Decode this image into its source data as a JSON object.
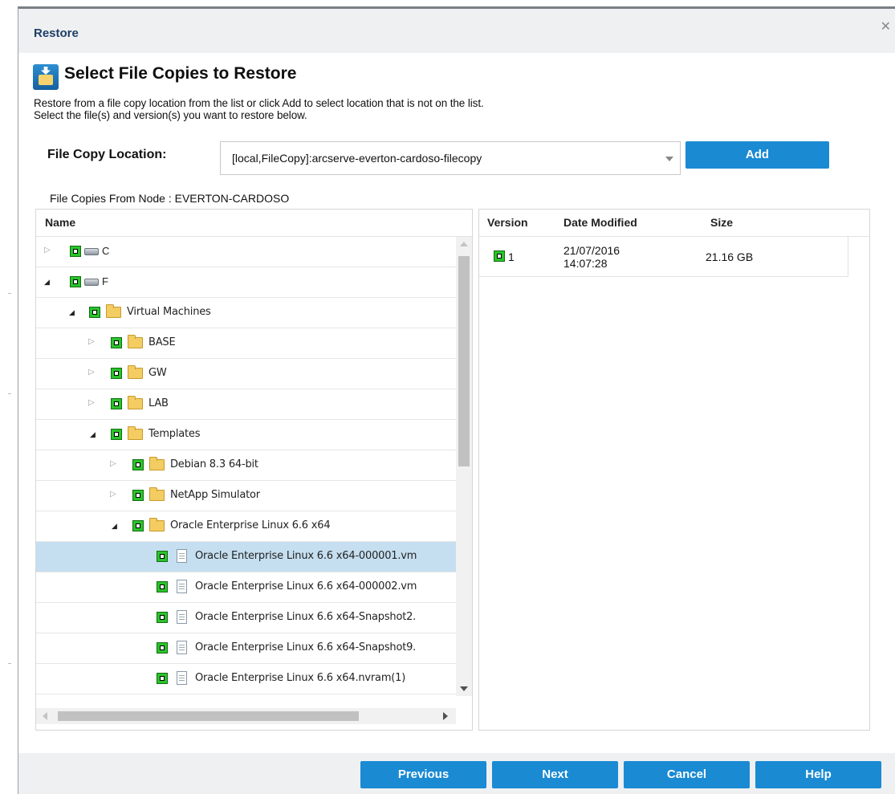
{
  "dialog": {
    "title": "Restore"
  },
  "header": {
    "title": "Select File Copies to Restore",
    "desc_line1": "Restore from a file copy location from the list or click Add to select location that is not on the list.",
    "desc_line2": "Select the file(s) and version(s) you want to restore below."
  },
  "location": {
    "label": "File Copy Location:",
    "value": "[local,FileCopy]:arcserve-everton-cardoso-filecopy",
    "add_label": "Add"
  },
  "node_label": "File Copies From Node : EVERTON-CARDOSO",
  "tree": {
    "header": "Name",
    "rows": [
      {
        "label": "C",
        "expanded": false,
        "icon": "drive-icon",
        "selected": false
      },
      {
        "label": "F",
        "expanded": true,
        "icon": "drive-icon",
        "selected": false
      },
      {
        "label": "Virtual Machines",
        "expanded": true,
        "icon": "folder-icon",
        "selected": false
      },
      {
        "label": "BASE",
        "expanded": false,
        "icon": "folder-icon",
        "selected": false
      },
      {
        "label": "GW",
        "expanded": false,
        "icon": "folder-icon",
        "selected": false
      },
      {
        "label": "LAB",
        "expanded": false,
        "icon": "folder-icon",
        "selected": false
      },
      {
        "label": "Templates",
        "expanded": true,
        "icon": "folder-icon",
        "selected": false
      },
      {
        "label": "Debian 8.3 64-bit",
        "expanded": false,
        "icon": "folder-icon",
        "selected": false
      },
      {
        "label": "NetApp Simulator",
        "expanded": false,
        "icon": "folder-icon",
        "selected": false
      },
      {
        "label": "Oracle Enterprise Linux 6.6 x64",
        "expanded": true,
        "icon": "folder-icon",
        "selected": false
      },
      {
        "label": "Oracle Enterprise Linux 6.6 x64-000001.vm",
        "icon": "file-icon",
        "selected": true
      },
      {
        "label": "Oracle Enterprise Linux 6.6 x64-000002.vm",
        "icon": "file-icon",
        "selected": false
      },
      {
        "label": "Oracle Enterprise Linux 6.6 x64-Snapshot2.",
        "icon": "file-icon",
        "selected": false
      },
      {
        "label": "Oracle Enterprise Linux 6.6 x64-Snapshot9.",
        "icon": "file-icon",
        "selected": false
      },
      {
        "label": "Oracle Enterprise Linux 6.6 x64.nvram(1)",
        "icon": "file-icon",
        "selected": false
      }
    ]
  },
  "versions": {
    "headers": {
      "version": "Version",
      "date": "Date Modified",
      "size": "Size"
    },
    "rows": [
      {
        "version": "1",
        "date_line1": "21/07/2016",
        "date_line2": "14:07:28",
        "size": "21.16 GB"
      }
    ]
  },
  "footer": {
    "previous": "Previous",
    "next": "Next",
    "cancel": "Cancel",
    "help": "Help"
  },
  "colors": {
    "accent": "#1a8ad3",
    "selection": "#c5dff0",
    "check": "#2bc32b",
    "title": "#1f3f66"
  }
}
